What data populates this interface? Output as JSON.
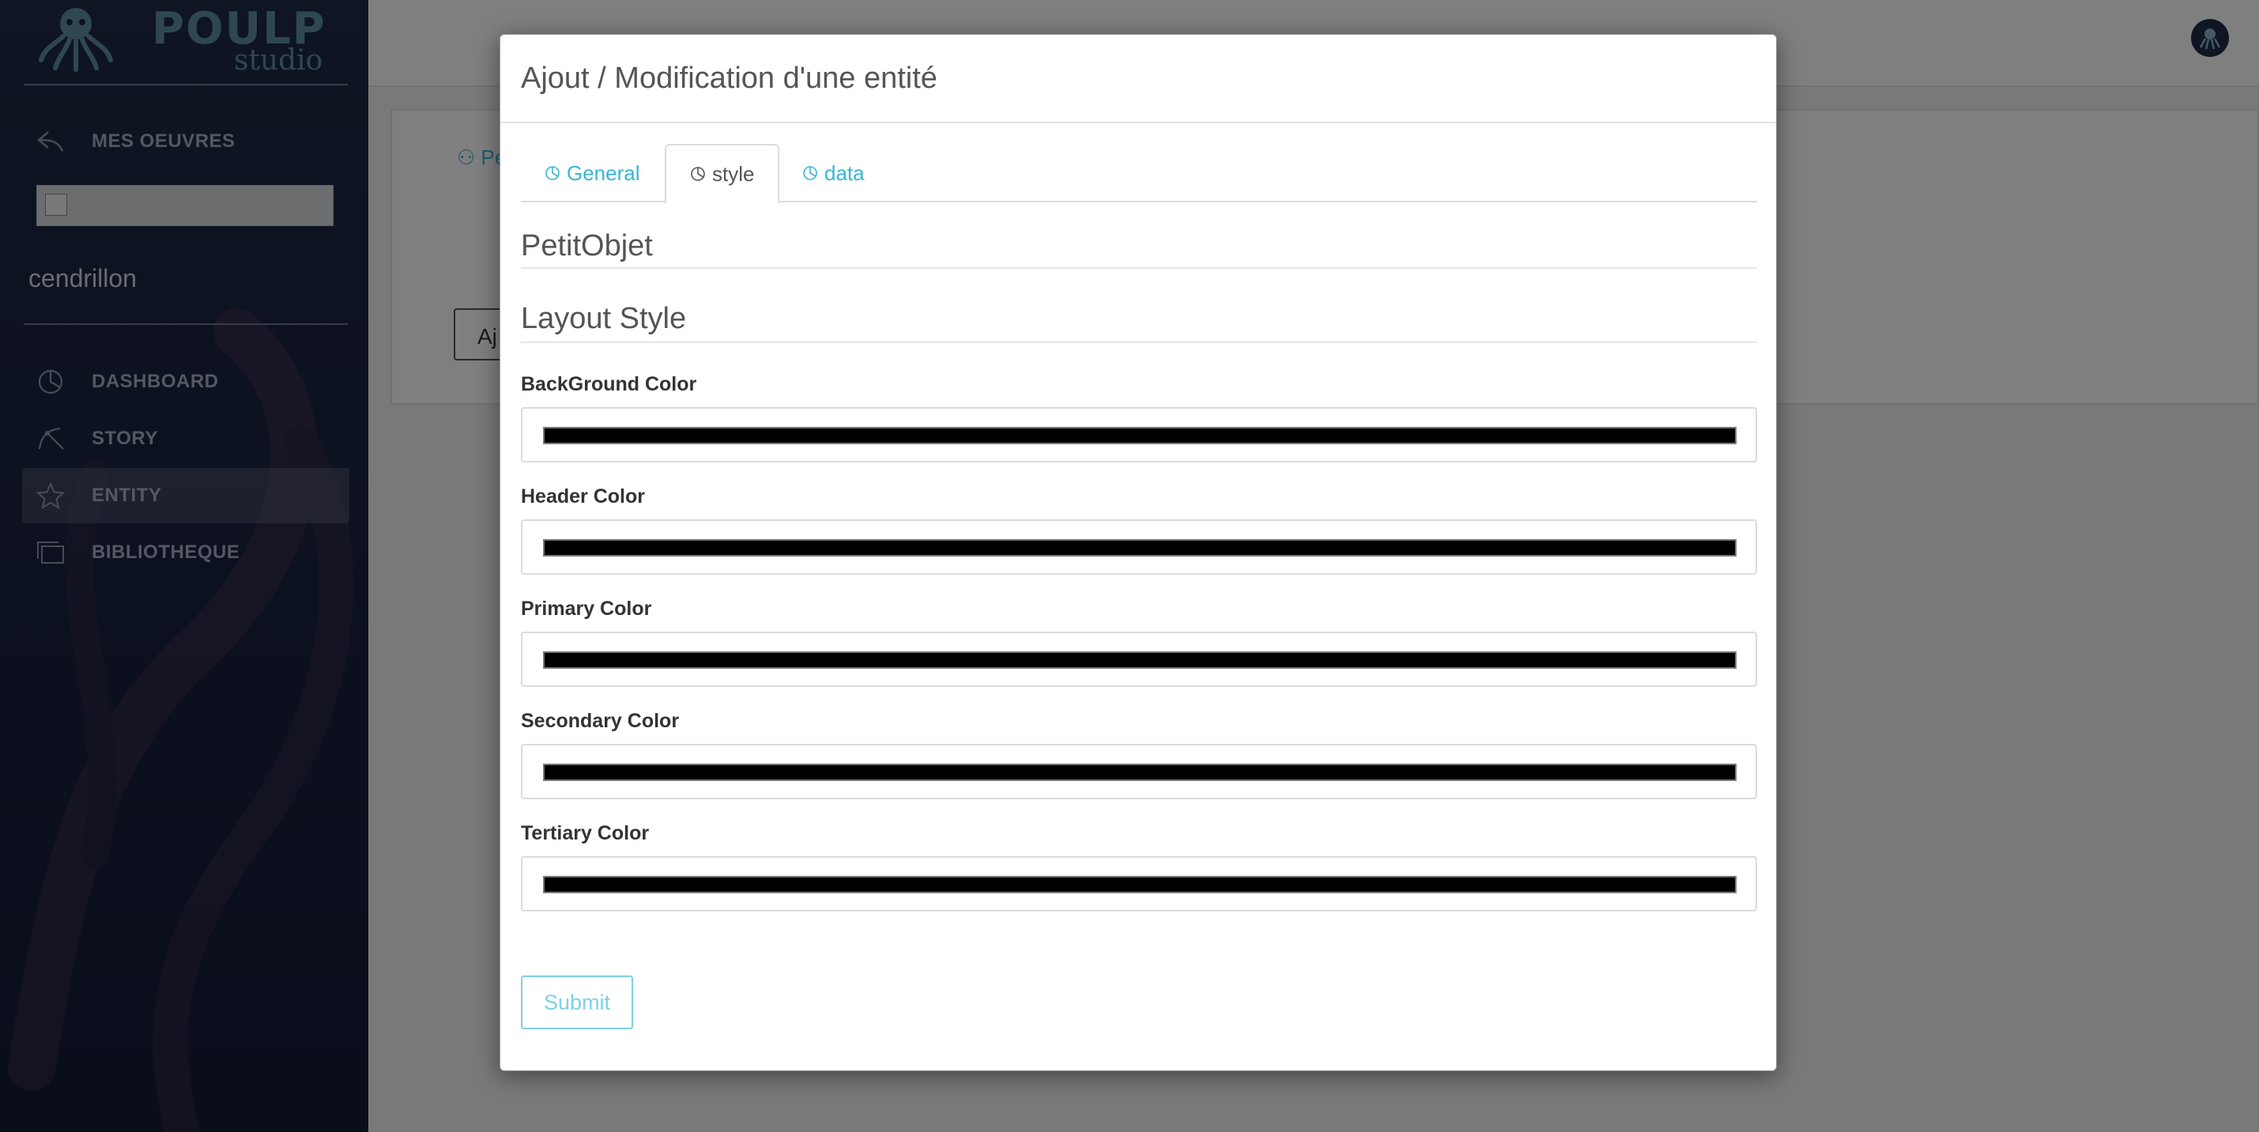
{
  "app": {
    "brand": "POULP",
    "brand_sub": "studio"
  },
  "sidebar": {
    "back_link": "MES OEUVRES",
    "project_name": "cendrillon",
    "items": [
      {
        "label": "DASHBOARD",
        "icon": "pie-icon",
        "active": false
      },
      {
        "label": "STORY",
        "icon": "branch-icon",
        "active": false
      },
      {
        "label": "ENTITY",
        "icon": "star-icon",
        "active": true
      },
      {
        "label": "BIBLIOTHEQUE",
        "icon": "library-icon",
        "active": false
      }
    ]
  },
  "background": {
    "panel_tab": "Pers",
    "panel_button": "Aj"
  },
  "modal": {
    "title": "Ajout / Modification d'une entité",
    "tabs": [
      {
        "label": "General",
        "active": false
      },
      {
        "label": "style",
        "active": true
      },
      {
        "label": "data",
        "active": false
      }
    ],
    "entity_name": "PetitObjet",
    "section": "Layout Style",
    "fields": [
      {
        "label": "BackGround Color",
        "value": "#000000"
      },
      {
        "label": "Header Color",
        "value": "#000000"
      },
      {
        "label": "Primary Color",
        "value": "#000000"
      },
      {
        "label": "Secondary Color",
        "value": "#000000"
      },
      {
        "label": "Tertiary Color",
        "value": "#000000"
      }
    ],
    "submit_label": "Submit"
  },
  "colors": {
    "accent": "#38b6d6",
    "sidebar_bg": "#1a2340",
    "brand": "#5e8fa5"
  }
}
